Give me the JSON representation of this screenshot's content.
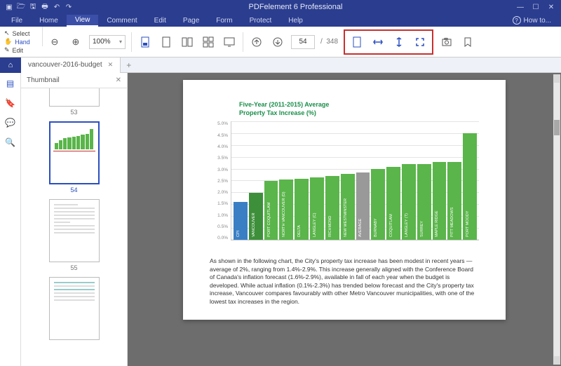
{
  "app": {
    "title": "PDFelement 6 Professional"
  },
  "menu": {
    "items": [
      "File",
      "Home",
      "View",
      "Comment",
      "Edit",
      "Page",
      "Form",
      "Protect",
      "Help"
    ],
    "active_index": 2,
    "howto": "How to..."
  },
  "left_tools": {
    "select": "Select",
    "hand": "Hand",
    "edit": "Edit"
  },
  "toolbar": {
    "zoom": "100%",
    "current_page": "54",
    "page_sep": "/",
    "total_pages": "348"
  },
  "tab": {
    "name": "vancouver-2016-budget"
  },
  "thumbnail_panel": {
    "title": "Thumbnail"
  },
  "thumbs": [
    {
      "label": "53"
    },
    {
      "label": "54"
    },
    {
      "label": "55"
    }
  ],
  "doc": {
    "chart_title_l1": "Five-Year (2011-2015) Average",
    "chart_title_l2": "Property Tax Increase (%)",
    "paragraph": "As shown in the following chart, the City's property tax increase has been modest in recent years — average of 2%, ranging from 1.4%-2.9%. This increase generally aligned with the Conference Board of Canada's inflation forecast (1.6%-2.9%), available in fall of each year when the budget is developed. While actual inflation (0.1%-2.3%) has trended below forecast and the City's property tax increase, Vancouver compares favourably with other Metro Vancouver municipalities, with one of the lowest tax increases in the region."
  },
  "chart_data": {
    "type": "bar",
    "title": "Five-Year (2011-2015) Average Property Tax Increase (%)",
    "ylabel": "%",
    "ylim": [
      0,
      5.0
    ],
    "y_ticks": [
      "5.0%",
      "4.5%",
      "4.0%",
      "3.5%",
      "3.0%",
      "2.5%",
      "2.0%",
      "1.5%",
      "1.0%",
      "0.5%",
      "0.0%"
    ],
    "categories": [
      "CPI",
      "VANCOUVER",
      "PORT COQUITLAM",
      "NORTH VANCOUVER (D)",
      "DELTA",
      "LANGLEY (C)",
      "RICHMOND",
      "NEW WESTMINSTER",
      "AVERAGE",
      "BURNABY",
      "COQUITLAM",
      "LANGLEY (T)",
      "SURREY",
      "MAPLE RIDGE",
      "PITT MEADOWS",
      "PORT MOODY"
    ],
    "values": [
      1.6,
      2.0,
      2.5,
      2.55,
      2.6,
      2.65,
      2.7,
      2.8,
      2.85,
      3.0,
      3.1,
      3.2,
      3.2,
      3.3,
      3.3,
      4.5
    ],
    "series_colors": [
      "blue",
      "db",
      "green",
      "green",
      "green",
      "green",
      "green",
      "green",
      "grey",
      "green",
      "green",
      "green",
      "green",
      "green",
      "green",
      "green"
    ]
  }
}
